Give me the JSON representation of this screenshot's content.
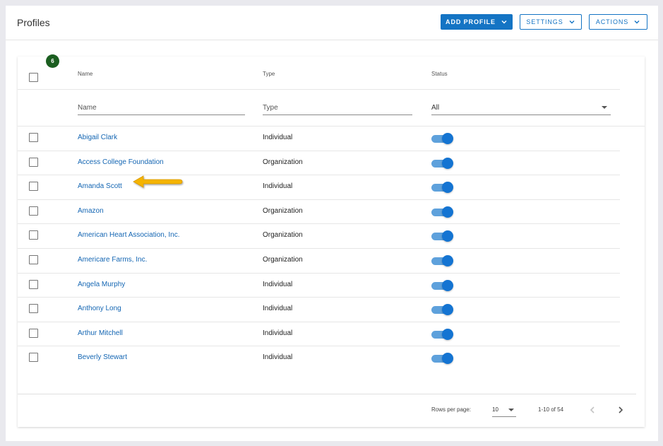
{
  "header": {
    "title": "Profiles",
    "add_profile_label": "ADD PROFILE",
    "settings_label": "SETTINGS",
    "actions_label": "ACTIONS"
  },
  "table": {
    "selected_count": "6",
    "columns": {
      "name": "Name",
      "type": "Type",
      "status": "Status"
    },
    "filters": {
      "name_placeholder": "Name",
      "type_placeholder": "Type",
      "status_value": "All"
    },
    "rows": [
      {
        "name": "Abigail Clark",
        "type": "Individual",
        "status": "on"
      },
      {
        "name": "Access College Foundation",
        "type": "Organization",
        "status": "on"
      },
      {
        "name": "Amanda Scott",
        "type": "Individual",
        "status": "on"
      },
      {
        "name": "Amazon",
        "type": "Organization",
        "status": "on"
      },
      {
        "name": "American Heart Association, Inc.",
        "type": "Organization",
        "status": "on"
      },
      {
        "name": "Americare Farms, Inc.",
        "type": "Organization",
        "status": "on"
      },
      {
        "name": "Angela Murphy",
        "type": "Individual",
        "status": "on"
      },
      {
        "name": "Anthony Long",
        "type": "Individual",
        "status": "on"
      },
      {
        "name": "Arthur Mitchell",
        "type": "Individual",
        "status": "on"
      },
      {
        "name": "Beverly Stewart",
        "type": "Individual",
        "status": "on"
      }
    ]
  },
  "pagination": {
    "rows_per_page_label": "Rows per page:",
    "rows_per_page_value": "10",
    "range_label": "1-10 of 54"
  },
  "colors": {
    "primary": "#1474c4",
    "link": "#1466b3",
    "badge": "#1b5e20",
    "toggle_on": "#1474d2",
    "annotation_arrow": "#f5b400"
  },
  "icons": {
    "dropdown": "chevron-down-icon",
    "prev": "chevron-left-icon",
    "next": "chevron-right-icon",
    "annotation": "pointer-arrow-icon"
  }
}
